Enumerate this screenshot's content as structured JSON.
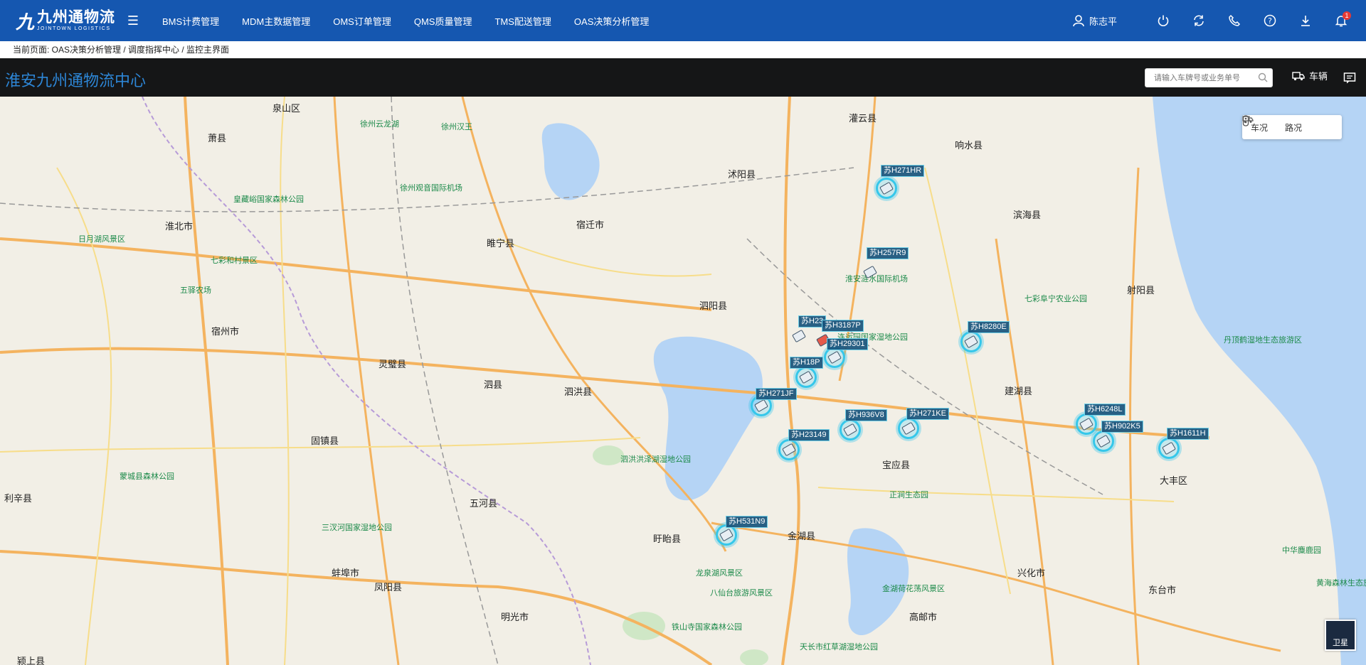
{
  "app": {
    "logo_cn": "九州通物流",
    "logo_en": "JOINTOWN LOGISTICS"
  },
  "nav": [
    {
      "label": "BMS计费管理"
    },
    {
      "label": "MDM主数据管理"
    },
    {
      "label": "OMS订单管理"
    },
    {
      "label": "QMS质量管理"
    },
    {
      "label": "TMS配送管理"
    },
    {
      "label": "OAS决策分析管理"
    }
  ],
  "user": {
    "name": "陈志平"
  },
  "notifications": {
    "count": "1"
  },
  "breadcrumb": "当前页面: OAS决策分析管理 / 调度指挥中心 / 监控主界面",
  "center": {
    "title": "淮安九州通物流中心",
    "search_placeholder": "请输入车牌号或业务单号",
    "vehicle_label": "车辆"
  },
  "map_controls": {
    "vehicle_status": "车况",
    "road_status": "路况",
    "satellite": "卫星"
  },
  "vehicles": [
    {
      "plate": "苏H271HR"
    },
    {
      "plate": "苏H257R9"
    },
    {
      "plate": "苏H23"
    },
    {
      "plate": "苏H3187P"
    },
    {
      "plate": "苏H29301"
    },
    {
      "plate": "苏H18P"
    },
    {
      "plate": "苏H271JF"
    },
    {
      "plate": "苏H8280E"
    },
    {
      "plate": "苏H936V8"
    },
    {
      "plate": "苏H271KE"
    },
    {
      "plate": "苏H23149"
    },
    {
      "plate": "苏H6248L"
    },
    {
      "plate": "苏H902K5"
    },
    {
      "plate": "苏H1611H"
    },
    {
      "plate": "苏H531N9"
    }
  ],
  "map_labels": {
    "cities": [
      "泉山区",
      "萧县",
      "淮北市",
      "宿州市",
      "灵璧县",
      "泗县",
      "泗洪县",
      "宿迁市",
      "睢宁县",
      "沭阳县",
      "灌云县",
      "响水县",
      "滨海县",
      "射阳县",
      "泗阳县",
      "建湖县",
      "宝应县",
      "金湖县",
      "盱眙县",
      "五河县",
      "固镇县",
      "蚌埠市",
      "凤阳县",
      "明光市",
      "高邮市",
      "兴化市",
      "东台市",
      "大丰区",
      "利辛县",
      "颍上县"
    ],
    "pois": [
      "徐州云龙湖",
      "徐州汉王",
      "徐州观音国际机场",
      "皇藏峪国家森林公园",
      "日月湖风景区",
      "七彩和村景区",
      "五驿农场",
      "连运园国家湿地公园",
      "淮安涟水国际机场",
      "七彩阜宁农业公园",
      "丹顶鹤湿地生态旅游区",
      "泗洪洪泽湖湿地公园",
      "蒙城县森林公园",
      "正涧生态园",
      "三汊河国家湿地公园",
      "龙泉湖风景区",
      "八仙台旅游风景区",
      "铁山寺国家森林公园",
      "金湖荷花荡风景区",
      "天长市红草湖湿地公园",
      "中华麋鹿园",
      "黄海森林生态旅游度假区"
    ]
  }
}
